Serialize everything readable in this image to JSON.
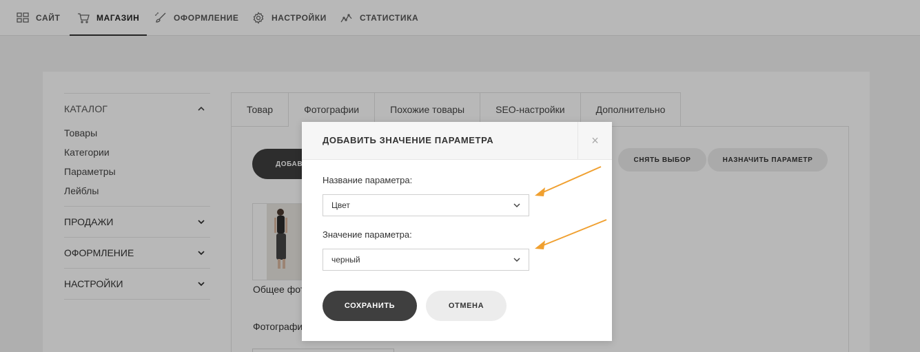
{
  "topnav": {
    "items": [
      {
        "label": "САЙТ",
        "icon": "grid-icon"
      },
      {
        "label": "МАГАЗИН",
        "icon": "cart-icon",
        "active": true
      },
      {
        "label": "ОФОРМЛЕНИЕ",
        "icon": "brush-icon"
      },
      {
        "label": "НАСТРОЙКИ",
        "icon": "gear-icon"
      },
      {
        "label": "СТАТИСТИКА",
        "icon": "stats-icon"
      }
    ]
  },
  "sidebar": {
    "catalog_label": "КАТАЛОГ",
    "catalog_items": [
      "Товары",
      "Категории",
      "Параметры",
      "Лейблы"
    ],
    "sections": [
      "ПРОДАЖИ",
      "ОФОРМЛЕНИЕ",
      "НАСТРОЙКИ"
    ]
  },
  "tabs": [
    "Товар",
    "Фотографии",
    "Похожие товары",
    "SEO-настройки",
    "Дополнительно"
  ],
  "active_tab": "Фотографии",
  "panel": {
    "add_button": "ДОБАВ",
    "deselect_button": "СНЯТЬ ВЫБОР",
    "assign_button": "НАЗНАЧИТЬ ПАРАМЕТР",
    "photo_caption": "Общее фото",
    "photos_label": "Фотография"
  },
  "modal": {
    "title": "ДОБАВИТЬ ЗНАЧЕНИЕ ПАРАМЕТРА",
    "close": "×",
    "param_name_label": "Название параметра:",
    "param_name_value": "Цвет",
    "param_value_label": "Значение параметра:",
    "param_value_value": "черный",
    "save": "СОХРАНИТЬ",
    "cancel": "ОТМЕНА"
  },
  "colors": {
    "accent_arrow": "#f0a030",
    "dark_button": "#3f3f3f",
    "light_button": "#ececec"
  }
}
